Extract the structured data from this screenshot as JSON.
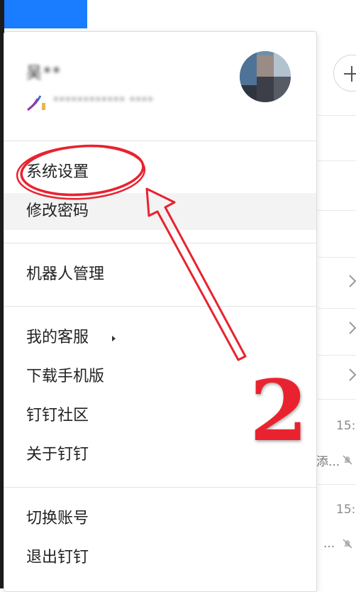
{
  "background": {
    "times": [
      "15:",
      "15:"
    ],
    "snippets": [
      "添...",
      "..."
    ]
  },
  "account": {
    "name": "吴**",
    "subtitle": "************ ****"
  },
  "menu": {
    "group1": [
      "系统设置",
      "修改密码"
    ],
    "group2": [
      "机器人管理"
    ],
    "group3": [
      "我的客服",
      "下载手机版",
      "钉钉社区",
      "关于钉钉"
    ],
    "group4": [
      "切换账号",
      "退出钉钉"
    ]
  },
  "annotation": {
    "step_number": "2"
  },
  "colors": {
    "accent_blue": "#1a7cff",
    "annotation_red": "#e8232f"
  },
  "icons": [
    "plus-icon",
    "chevron-right-icon",
    "mute-bell-icon",
    "submenu-arrow-icon"
  ]
}
